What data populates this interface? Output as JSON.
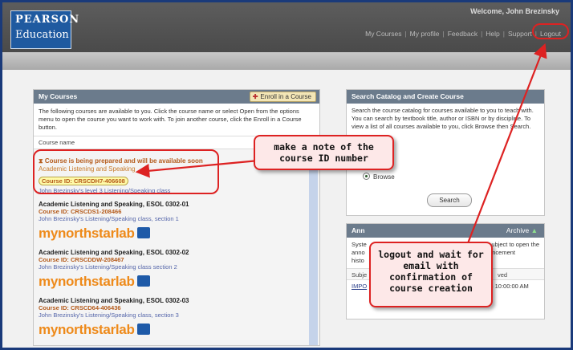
{
  "header": {
    "logo_line1": "PEARSON",
    "logo_line2": "Education",
    "welcome": "Welcome, John Brezinsky",
    "nav": [
      "My Courses",
      "My profile",
      "Feedback",
      "Help",
      "Support",
      "Logout"
    ]
  },
  "my_courses": {
    "title": "My Courses",
    "enroll_label": "Enroll in a Course",
    "intro": "The following courses are available to you. Click the course name or select Open from the options menu to open the course you want to work with. To join another course, click the Enroll in a Course button.",
    "column_header": "Course name",
    "pending": {
      "status": "Course is being prepared and will be available soon",
      "name": "Academic Listening and Speaking",
      "course_id": "Course ID: CRSCDH7-406608",
      "description": "John Brezinsky's level 3 Listening/Speaking class"
    },
    "courses": [
      {
        "title": "Academic Listening and Speaking, ESOL 0302-01",
        "course_id": "Course ID: CRSCDS1-208466",
        "description": "John Brezinsky's Listening/Speaking class, section 1",
        "logo": "mynorthstarlab"
      },
      {
        "title": "Academic Listening and Speaking, ESOL 0302-02",
        "course_id": "Course ID: CRSCDDW-208467",
        "description": "John Brezinsky's Listening/Speaking class section 2",
        "logo": "mynorthstarlab"
      },
      {
        "title": "Academic Listening and Speaking, ESOL 0302-03",
        "course_id": "Course ID: CRSCD64-406436",
        "description": "John Brezinsky's Listening/Speaking class, section 3",
        "logo": "mynorthstarlab"
      }
    ]
  },
  "search_catalog": {
    "title": "Search Catalog and Create Course",
    "text": "Search the course catalog for courses available to you to teach with. You can search by textbook title, author or ISBN or by discipline. To view a list of all courses available to you, click Browse then Search.",
    "browse_label": "Browse",
    "search_button": "Search"
  },
  "announcements": {
    "title": "Ann",
    "archive_label": "Archive",
    "text_line1": "Syste",
    "text_line1b": "ubject to open the",
    "text_line2": "anno",
    "text_line2b": "ouncement",
    "text_line3": "histo",
    "col_subject": "Subje",
    "col_posted": "ved",
    "row_subject": "IMPO",
    "row_date": "008 10:00:00 AM"
  },
  "callouts": {
    "note": "make a note of the course ID number",
    "logout": "logout and wait for email with confirmation of course creation"
  },
  "colors": {
    "header_bg": "#4f4f4f",
    "logo_bg": "#1f5aa0",
    "panel_head": "#6b7b8c",
    "course_id": "#b45a1a",
    "brand_orange": "#ee8a1a",
    "callout_border": "#dd2222",
    "callout_bg": "#fde8e8"
  }
}
